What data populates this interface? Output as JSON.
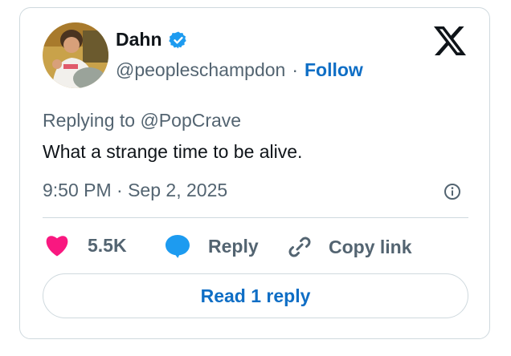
{
  "author": {
    "name": "Dahn",
    "handle": "@peopleschampdon",
    "separator": "·",
    "follow_label": "Follow"
  },
  "tweet": {
    "replying_to": "Replying to @PopCrave",
    "text": "What a strange time to be alive.",
    "timestamp": "9:50 PM · Sep 2, 2025"
  },
  "actions": {
    "likes": "5.5K",
    "reply_label": "Reply",
    "copy_label": "Copy link"
  },
  "read_replies_label": "Read 1 reply",
  "icons": {
    "logo": "x-logo-icon",
    "verified": "verified-badge-icon",
    "info": "info-icon",
    "like": "heart-icon",
    "reply": "speech-bubble-icon",
    "copy": "link-icon"
  },
  "colors": {
    "link_blue": "#0f6ec5",
    "like_pink": "#f91880",
    "reply_blue": "#1d9bf0",
    "verified_blue": "#1d9bf0",
    "secondary_text": "#536471",
    "border": "#cfd9de"
  }
}
